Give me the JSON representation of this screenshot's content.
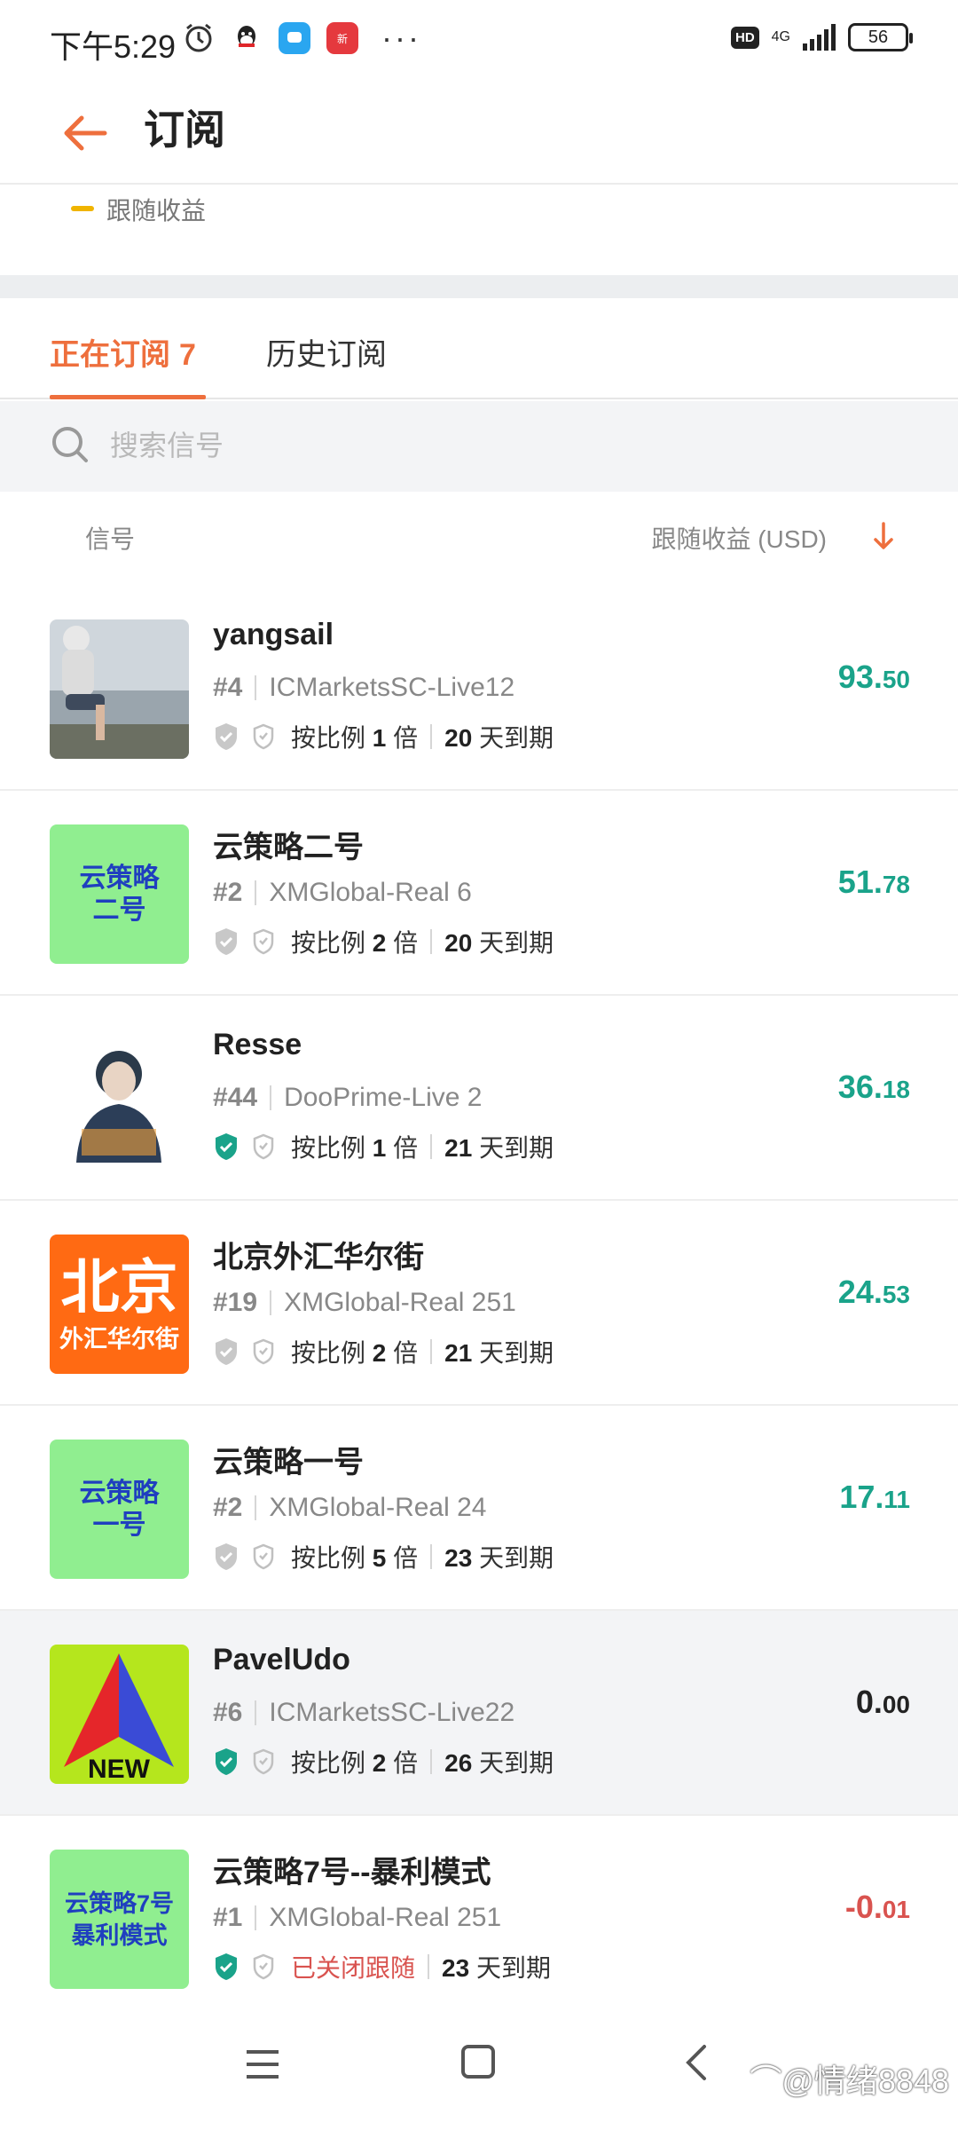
{
  "status_bar": {
    "time": "下午5:29",
    "hd": "HD",
    "network": "4G",
    "battery": "56"
  },
  "header": {
    "title": "订阅"
  },
  "legend": {
    "label": "跟随收益",
    "color": "#f0b400"
  },
  "tabs": {
    "active_label": "正在订阅",
    "active_count": "7",
    "history_label": "历史订阅"
  },
  "search": {
    "placeholder": "搜索信号"
  },
  "columns": {
    "signal": "信号",
    "profit": "跟随收益 (USD)"
  },
  "accent_color": "#ee6f3d",
  "positive_color": "#1aa38a",
  "negative_color": "#d9534f",
  "signals": [
    {
      "name": "yangsail",
      "rank": "#4",
      "server": "ICMarketsSC-Live12",
      "ratio_prefix": "按比例",
      "ratio": "1",
      "ratio_suffix": "倍",
      "days": "20",
      "days_suffix": "天到期",
      "profit_int": "93.",
      "profit_dec": "50",
      "verified": false
    },
    {
      "name": "云策略二号",
      "rank": "#2",
      "server": "XMGlobal-Real 6",
      "ratio_prefix": "按比例",
      "ratio": "2",
      "ratio_suffix": "倍",
      "days": "20",
      "days_suffix": "天到期",
      "profit_int": "51.",
      "profit_dec": "78",
      "verified": false,
      "avatar_text": [
        "云策略",
        "二号"
      ]
    },
    {
      "name": "Resse",
      "rank": "#44",
      "server": "DooPrime-Live 2",
      "ratio_prefix": "按比例",
      "ratio": "1",
      "ratio_suffix": "倍",
      "days": "21",
      "days_suffix": "天到期",
      "profit_int": "36.",
      "profit_dec": "18",
      "verified": true
    },
    {
      "name": "北京外汇华尔街",
      "rank": "#19",
      "server": "XMGlobal-Real 251",
      "ratio_prefix": "按比例",
      "ratio": "2",
      "ratio_suffix": "倍",
      "days": "21",
      "days_suffix": "天到期",
      "profit_int": "24.",
      "profit_dec": "53",
      "verified": false,
      "avatar_text": [
        "北京",
        "外汇华尔街"
      ]
    },
    {
      "name": "云策略一号",
      "rank": "#2",
      "server": "XMGlobal-Real 24",
      "ratio_prefix": "按比例",
      "ratio": "5",
      "ratio_suffix": "倍",
      "days": "23",
      "days_suffix": "天到期",
      "profit_int": "17.",
      "profit_dec": "11",
      "verified": false,
      "avatar_text": [
        "云策略",
        "一号"
      ]
    },
    {
      "name": "PavelUdo",
      "rank": "#6",
      "server": "ICMarketsSC-Live22",
      "ratio_prefix": "按比例",
      "ratio": "2",
      "ratio_suffix": "倍",
      "days": "26",
      "days_suffix": "天到期",
      "profit_int": "0.",
      "profit_dec": "00",
      "verified": true,
      "avatar_text": [
        "NEW"
      ]
    },
    {
      "name": "云策略7号--暴利模式",
      "rank": "#1",
      "server": "XMGlobal-Real 251",
      "closed_label": "已关闭跟随",
      "days": "23",
      "days_suffix": "天到期",
      "profit_int": "-0.",
      "profit_dec": "01",
      "verified": true,
      "avatar_text": [
        "云策略7号",
        "暴利模式"
      ]
    }
  ],
  "watermark": "⌒@情绪8848"
}
